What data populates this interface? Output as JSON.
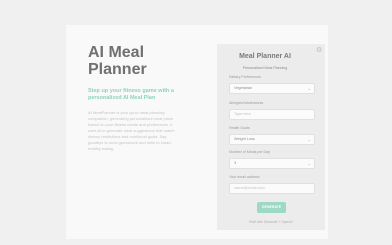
{
  "hero": {
    "title": "AI Meal\nPlanner",
    "subtitle": "Step up your fitness game with a personalized AI Meal Plan",
    "description": "AI MealPlanner is your go-to meal planning companion, generating personalized meal plans based on your fitness needs and preferences. It uses AI to generate meal suggestions that match dietary restrictions and nutritional goals. Say goodbye to meal guesswork and hello to smart, healthy eating."
  },
  "form": {
    "title": "Meal Planner AI",
    "subtitle": "Personalized Meal Planning",
    "dietary": {
      "label": "Dietary Preferences",
      "value": "Vegetarian"
    },
    "allergies": {
      "label": "Allergies/Intolerances",
      "placeholder": "Type here"
    },
    "goals": {
      "label": "Health Goals",
      "value": "Weight Loss"
    },
    "meals": {
      "label": "Number of Meals per Day",
      "value": "3"
    },
    "email": {
      "label": "Your email address",
      "placeholder": "name@email.com"
    },
    "generate_label": "GENERATE",
    "footer_note": "Built with Streamlit + OpenAI"
  },
  "colors": {
    "accent": "#9ed8c6",
    "subtitle_accent": "#8ed3b8",
    "background": "#f0f0f0"
  },
  "icons": {
    "settings": "settings-icon",
    "chevron": "chevron-down-icon"
  }
}
